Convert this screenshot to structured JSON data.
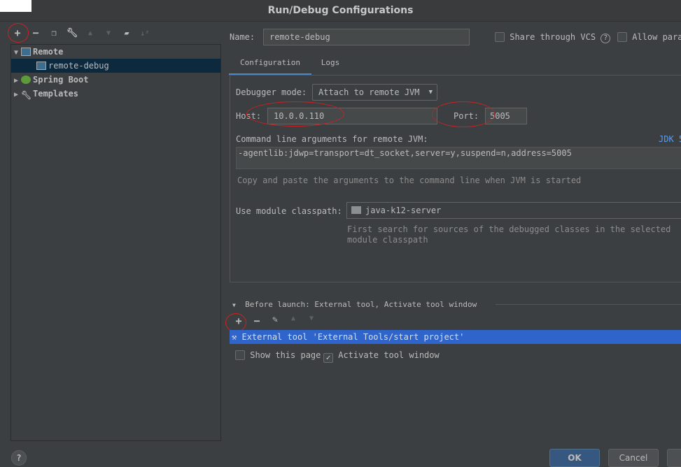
{
  "window": {
    "title": "Run/Debug Configurations"
  },
  "toolbar": {
    "icons": [
      "plus-icon",
      "minus-icon",
      "copy-icon",
      "wrench-icon",
      "arrow-up-icon",
      "arrow-down-icon",
      "new-folder-icon",
      "sort-icon"
    ]
  },
  "tree": {
    "items": [
      {
        "label": "Remote",
        "expanded": true
      },
      {
        "label": "remote-debug",
        "selected": true
      },
      {
        "label": "Spring Boot",
        "expanded": false
      },
      {
        "label": "Templates",
        "expanded": false
      }
    ]
  },
  "form": {
    "name_label": "Name:",
    "name_value": "remote-debug",
    "share_label": "Share through VCS",
    "allow_label": "Allow para",
    "tabs": [
      {
        "label": "Configuration",
        "active": true
      },
      {
        "label": "Logs"
      }
    ],
    "debugger_mode_label": "Debugger mode:",
    "debugger_mode_value": "Attach to remote JVM",
    "host_label": "Host:",
    "host_value": "10.0.0.110",
    "port_label": "Port:",
    "port_value": "5005",
    "cmd_label": "Command line arguments for remote JVM:",
    "jdk_link": "JDK 5",
    "cmd_value": "-agentlib:jdwp=transport=dt_socket,server=y,suspend=n,address=5005",
    "cmd_hint": "Copy and paste the arguments to the command line when JVM is started",
    "module_label": "Use module classpath:",
    "module_value": "java-k12-server",
    "module_hint": "First search for sources of the debugged classes in the selected module classpath"
  },
  "before_launch": {
    "title": "Before launch: External tool, Activate tool window",
    "items": [
      "External tool 'External Tools/start project'"
    ],
    "show_page_label": "Show this page",
    "show_page_checked": false,
    "activate_label": "Activate tool window",
    "activate_checked": true
  },
  "buttons": {
    "help": "?",
    "ok": "OK",
    "cancel": "Cancel"
  },
  "colors": {
    "accent": "#4a88c7",
    "selection": "#2f65ca",
    "tree_selection": "#0d293e",
    "annotation": "#d02020"
  }
}
